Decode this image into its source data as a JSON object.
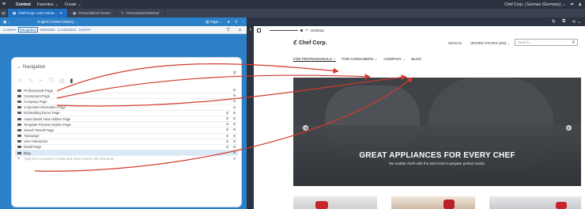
{
  "topbar": {
    "content": "Content",
    "favorites": "Favorites",
    "create": "Create",
    "site_selector": "Chef Corp. | German (Germany)"
  },
  "tabs": [
    {
      "label": "Chef Corp. USA Home..."
    },
    {
      "label": "Personalized Teaser"
    },
    {
      "label": "Personalized Banner"
    }
  ],
  "left_toolbar": {
    "language": "English (United States)",
    "page_label": "Page"
  },
  "subtabs": [
    "Content",
    "Navigation",
    "Metadata",
    "Localization",
    "System"
  ],
  "navigation": {
    "title": "Navigation",
    "items": [
      {
        "label": "Professionals Page"
      },
      {
        "label": "Consumers Page"
      },
      {
        "label": "Company Page"
      },
      {
        "label": "Corporate Information Page"
      },
      {
        "label": "Embedding Demo Page"
      },
      {
        "label": "Asset Detail View Hidden Page"
      },
      {
        "label": "Template Preview Hidden Page"
      },
      {
        "label": "Search Result Page"
      },
      {
        "label": "Topicpage"
      },
      {
        "label": "User Interaction"
      },
      {
        "label": "Detail Page"
      },
      {
        "label": "Blog"
      }
    ],
    "add_placeholder": "Type here to search or drag and drop content onto this area"
  },
  "preview": {
    "device": "Desktop",
    "site": {
      "logo": "Chef Corp.",
      "signin": "SIGN IN",
      "country": "UNITED STATES (EN)",
      "search_placeholder": "Search...",
      "nav": [
        "FOR PROFESSIONALS",
        "FOR CONSUMERS",
        "COMPANY",
        "BLOG"
      ],
      "hero_title": "GREAT APPLIANCES FOR EVERY CHEF",
      "hero_subtitle": "We enable chefs with the best tools to prepare perfect meals."
    }
  },
  "colors": {
    "accent": "#2b80c7",
    "dark": "#2c3240",
    "arrow": "#d23a2c"
  }
}
